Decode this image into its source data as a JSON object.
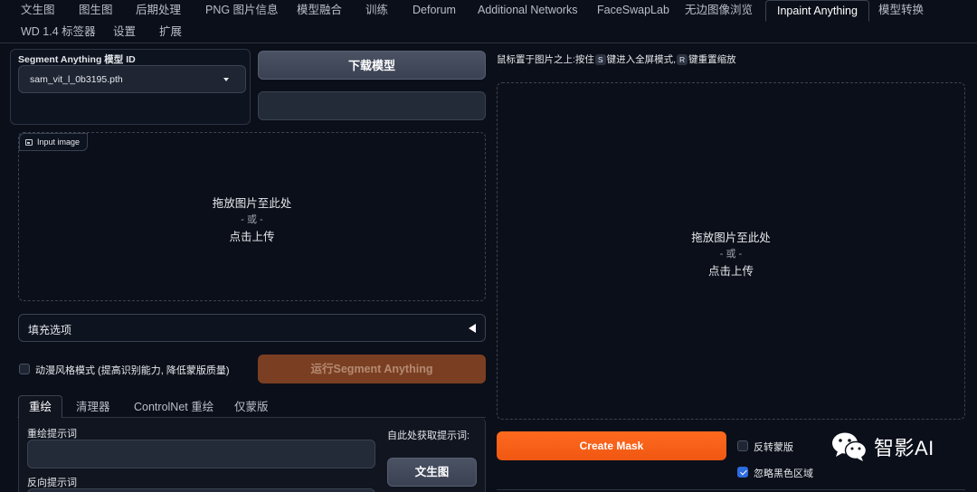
{
  "tabs": [
    {
      "label": "文生图"
    },
    {
      "label": "图生图"
    },
    {
      "label": "后期处理"
    },
    {
      "label": "PNG 图片信息"
    },
    {
      "label": "模型融合"
    },
    {
      "label": "训练"
    },
    {
      "label": "Deforum"
    },
    {
      "label": "Additional Networks"
    },
    {
      "label": "FaceSwapLab"
    },
    {
      "label": "无边图像浏览"
    },
    {
      "label": "Inpaint Anything"
    },
    {
      "label": "模型转换"
    },
    {
      "label": "WD 1.4 标签器"
    },
    {
      "label": "设置"
    },
    {
      "label": "扩展"
    }
  ],
  "active_tab": "Inpaint Anything",
  "left": {
    "model_label": "Segment Anything 模型 ID",
    "model_value": "sam_vit_l_0b3195.pth",
    "download_button": "下载模型",
    "input_image_label": "Input image",
    "drop_line1": "拖放图片至此处",
    "drop_or": "- 或 -",
    "drop_line2": "点击上传",
    "fill_options": "填充选项",
    "anime_checkbox": "动漫风格模式 (提高识别能力, 降低蒙版质量)",
    "anime_checked": false,
    "run_button": "运行Segment Anything",
    "subtabs": [
      {
        "label": "重绘"
      },
      {
        "label": "清理器"
      },
      {
        "label": "ControlNet 重绘"
      },
      {
        "label": "仅蒙版"
      }
    ],
    "prompt_label": "重绘提示词",
    "negative_label": "反向提示词",
    "get_prompt_label": "自此处获取提示词:",
    "txt2img_button": "文生图"
  },
  "right": {
    "hint_prefix": "鼠标置于图片之上:按住",
    "hint_key1": "S",
    "hint_mid": "键进入全屏模式,",
    "hint_key2": "R",
    "hint_suffix": "键重置缩放",
    "drop_line1": "拖放图片至此处",
    "drop_or": "- 或 -",
    "drop_line2": "点击上传",
    "create_mask_button": "Create Mask",
    "invert_mask": "反转蒙版",
    "invert_checked": false,
    "ignore_black": "忽略黑色区域",
    "ignore_checked": true
  },
  "watermark": {
    "text": "智影AI",
    "icon": "wechat-icon"
  },
  "colors": {
    "accent": "#f05712",
    "background": "#0b0f19",
    "checkbox_checked": "#2c6be0"
  }
}
